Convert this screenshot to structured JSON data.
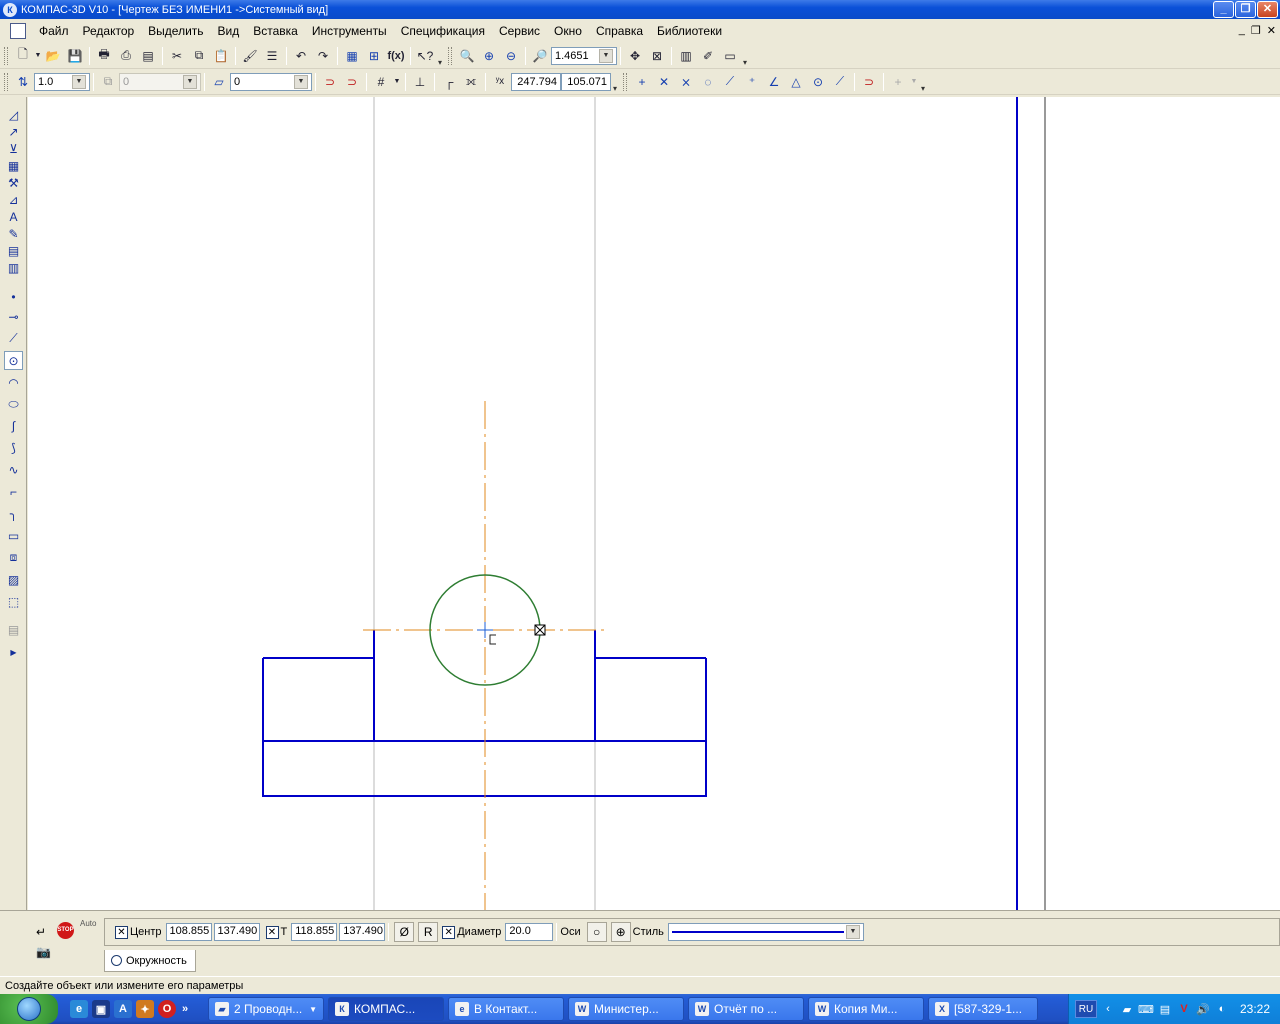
{
  "window": {
    "title": "КОМПАС-3D V10 - [Чертеж БЕЗ ИМЕНИ1 ->Системный вид]",
    "app_icon": "К"
  },
  "menu": {
    "items": [
      {
        "label": "Файл"
      },
      {
        "label": "Редактор"
      },
      {
        "label": "Выделить"
      },
      {
        "label": "Вид"
      },
      {
        "label": "Вставка"
      },
      {
        "label": "Инструменты"
      },
      {
        "label": "Спецификация"
      },
      {
        "label": "Сервис"
      },
      {
        "label": "Окно"
      },
      {
        "label": "Справка"
      },
      {
        "label": "Библиотеки"
      }
    ]
  },
  "toolbar_standard": {
    "zoom_value": "1.4651",
    "fx_label": "f(x)"
  },
  "toolbar_current_state": {
    "step_value": "1.0",
    "view_value": "0",
    "layer_value": "0",
    "coord_x": "247.794",
    "coord_y": "105.071"
  },
  "property_panel": {
    "center_label": "Центр",
    "center_x": "108.855",
    "center_y": "137.490",
    "point_label": "Т",
    "point_x": "118.855",
    "point_y": "137.490",
    "diameter_symbol": "Ø",
    "radius_button": "R",
    "diameter_label": "Диаметр",
    "diameter_value": "20.0",
    "axes_label": "Оси",
    "style_label": "Стиль",
    "auto_label": "Auto",
    "stop_label": "STOP",
    "tab_label": "Окружность"
  },
  "status": {
    "message": "Создайте объект или измените его параметры"
  },
  "taskbar": {
    "tasks": [
      {
        "label": "2 Проводн...",
        "icon": "folder-icon"
      },
      {
        "label": "КОМПАС...",
        "icon": "kompas-icon",
        "active": true
      },
      {
        "label": "В Контакт...",
        "icon": "ie-icon"
      },
      {
        "label": "Министер...",
        "icon": "word-icon"
      },
      {
        "label": "Отчёт по ...",
        "icon": "word-icon"
      },
      {
        "label": "Копия Ми...",
        "icon": "word-icon"
      },
      {
        "label": "[587-329-1...",
        "icon": "excel-icon"
      }
    ],
    "lang": "RU",
    "clock": "23:22"
  },
  "colors": {
    "drawing_line": "#0000c8",
    "axis_line": "#e08a1e",
    "circle": "#2e7d32",
    "construction_line": "#b8b8b8",
    "titlebar": "#0a4bc9"
  }
}
